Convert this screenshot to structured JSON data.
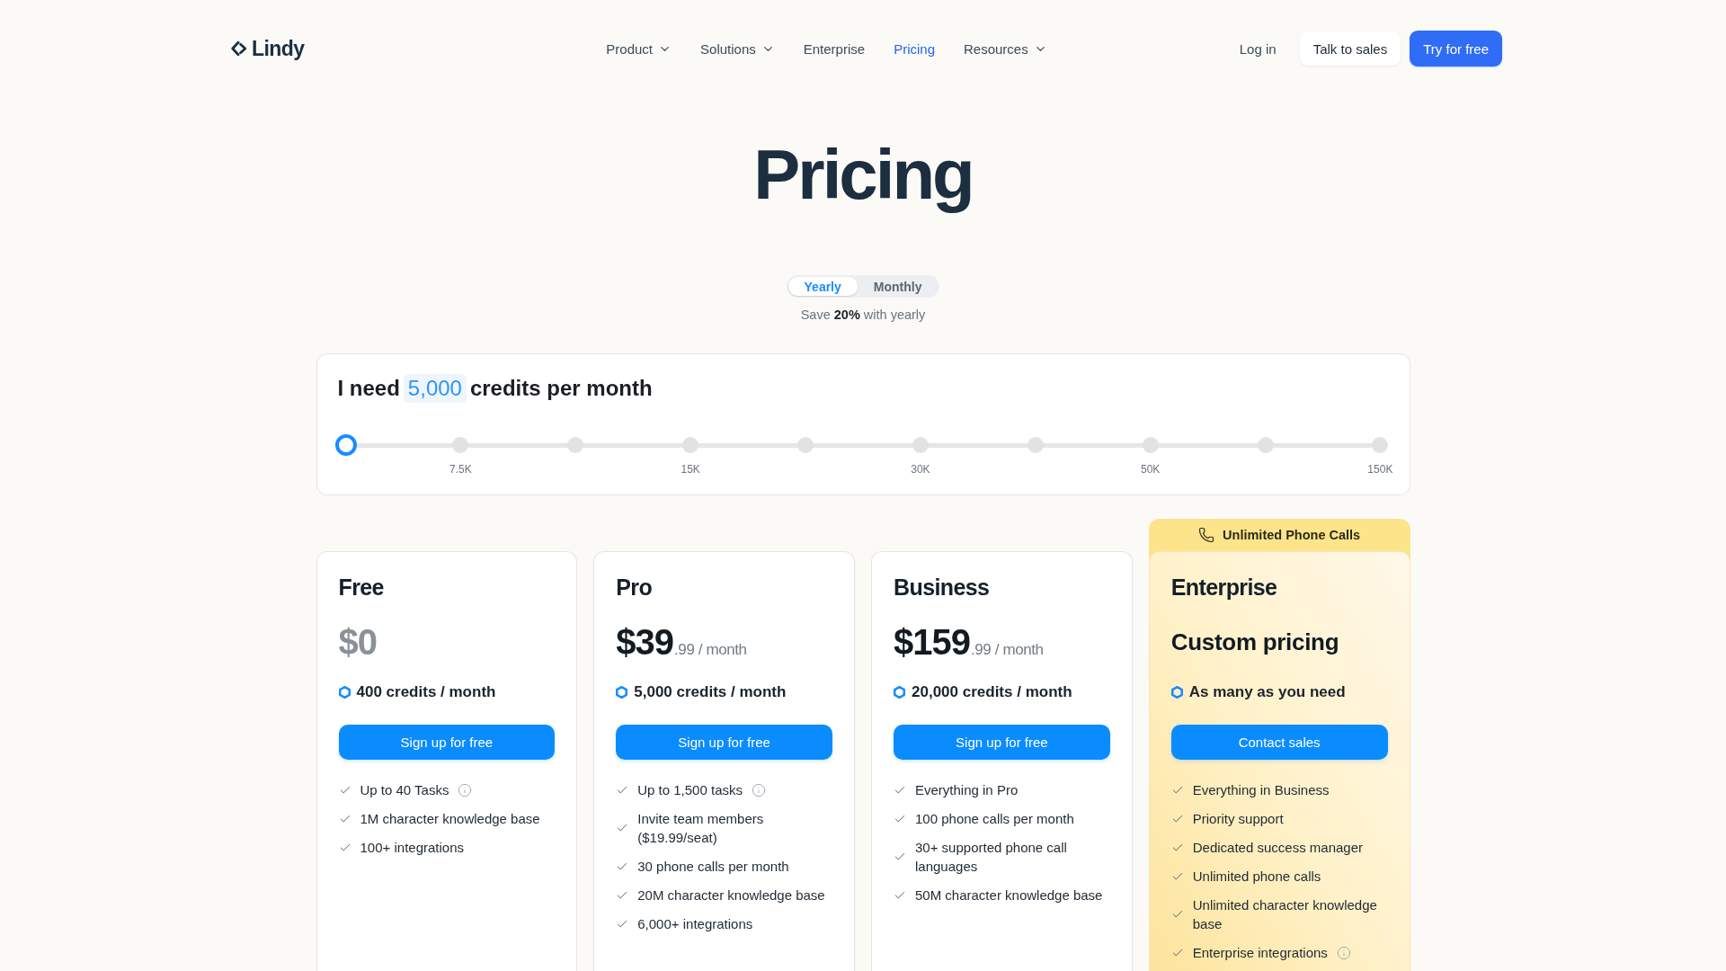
{
  "nav": {
    "logo": "Lindy",
    "links": [
      {
        "label": "Product",
        "dropdown": true,
        "selected": false
      },
      {
        "label": "Solutions",
        "dropdown": true,
        "selected": false
      },
      {
        "label": "Enterprise",
        "dropdown": false,
        "selected": false
      },
      {
        "label": "Pricing",
        "dropdown": false,
        "selected": true
      },
      {
        "label": "Resources",
        "dropdown": true,
        "selected": false
      }
    ],
    "login": "Log in",
    "buttons": [
      {
        "label": "Talk to sales",
        "kind": "secondary"
      },
      {
        "label": "Try for free",
        "kind": "primary"
      }
    ]
  },
  "hero": {
    "title": "Pricing"
  },
  "billing_toggle": {
    "options": [
      {
        "label": "Yearly",
        "selected": true
      },
      {
        "label": "Monthly",
        "selected": false
      }
    ],
    "note": "Save **20%** with yearly"
  },
  "credits_slider": {
    "prefix": "I need",
    "value": "5,000",
    "suffix": "credits per month",
    "level": 0,
    "tick_labels": [
      "7.5K",
      "15K",
      "30K",
      "50K",
      "150K"
    ]
  },
  "plans": [
    {
      "name": "Free",
      "kind": "free",
      "featured": false,
      "price": "$0",
      "credits": "400 credits / month",
      "button": "Sign up for free",
      "features": [
        {
          "text": "Up to 40 Tasks",
          "info": true
        },
        {
          "text": "1M character knowledge base",
          "info": false
        },
        {
          "text": "100+ integrations",
          "info": false
        }
      ]
    },
    {
      "name": "Pro",
      "kind": "paid",
      "featured": false,
      "price": "$39",
      "price_suffix": ".99 / month",
      "credits": "5,000 credits / month",
      "button": "Sign up for free",
      "features": [
        {
          "text": "Up to 1,500 tasks",
          "info": true
        },
        {
          "text": "Invite team members ($19.99/seat)",
          "info": false
        },
        {
          "text": "30 phone calls per month",
          "info": false
        },
        {
          "text": "20M character knowledge base",
          "info": false
        },
        {
          "text": "6,000+ integrations",
          "info": false
        }
      ]
    },
    {
      "name": "Business",
      "kind": "paid",
      "featured": false,
      "price": "$159",
      "price_suffix": ".99 / month",
      "credits": "20,000 credits / month",
      "button": "Sign up for free",
      "features": [
        {
          "text": "Everything in Pro",
          "info": false
        },
        {
          "text": "100 phone calls per month",
          "info": false
        },
        {
          "text": "30+ supported phone call languages",
          "info": false
        },
        {
          "text": "50M character knowledge base",
          "info": false
        }
      ]
    },
    {
      "name": "Enterprise",
      "kind": "custom",
      "featured": true,
      "banner": "Unlimited Phone Calls",
      "price": "Custom pricing",
      "credits": "As many as you need",
      "button": "Contact sales",
      "features": [
        {
          "text": "Everything in Business",
          "info": false
        },
        {
          "text": "Priority support",
          "info": false
        },
        {
          "text": "Dedicated success manager",
          "info": false
        },
        {
          "text": "Unlimited phone calls",
          "info": false
        },
        {
          "text": "Unlimited character knowledge base",
          "info": false
        },
        {
          "text": "Enterprise integrations",
          "info": true
        }
      ]
    }
  ]
}
